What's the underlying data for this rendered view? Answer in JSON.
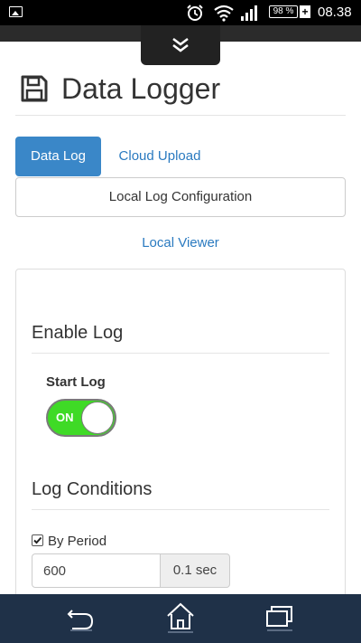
{
  "status_bar": {
    "battery": "98 %",
    "battery_plus": "+",
    "time": "08.38",
    "icons": [
      "image-icon",
      "alarm-icon",
      "wifi-icon",
      "signal-icon",
      "battery-icon"
    ]
  },
  "pulltab": {
    "icon": "double-chevron-down-icon"
  },
  "page": {
    "icon": "floppy-disk-icon",
    "title": "Data Logger"
  },
  "tabs": [
    {
      "label": "Data Log",
      "active": true
    },
    {
      "label": "Cloud Upload",
      "active": false
    }
  ],
  "local_log_config_label": "Local Log Configuration",
  "local_viewer_label": "Local Viewer",
  "enable_log": {
    "heading": "Enable Log",
    "start_log_label": "Start Log",
    "switch_state": "ON"
  },
  "log_conditions": {
    "heading": "Log Conditions",
    "by_period_label": "By Period",
    "by_period_checked": true,
    "period_value": "600",
    "period_unit": "0.1 sec"
  },
  "nav_bar": {
    "icons": [
      "back-icon",
      "home-icon",
      "recent-apps-icon"
    ]
  },
  "colors": {
    "accent": "#3a87c8",
    "link": "#2a7ac0",
    "switch_on": "#3fda26",
    "nav_bar": "#1f3148"
  }
}
